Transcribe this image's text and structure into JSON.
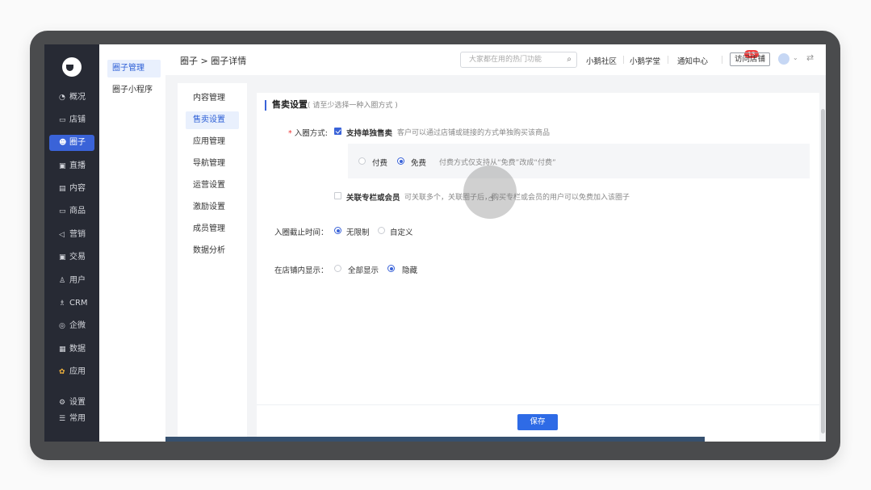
{
  "nav": {
    "items": [
      {
        "icon": "chart-icon",
        "label": "概况"
      },
      {
        "icon": "store-icon",
        "label": "店铺"
      },
      {
        "icon": "circle-group-icon",
        "label": "圈子"
      },
      {
        "icon": "live-icon",
        "label": "直播"
      },
      {
        "icon": "content-icon",
        "label": "内容"
      },
      {
        "icon": "goods-icon",
        "label": "商品"
      },
      {
        "icon": "marketing-icon",
        "label": "营销"
      },
      {
        "icon": "trade-icon",
        "label": "交易"
      },
      {
        "icon": "user-icon",
        "label": "用户"
      },
      {
        "icon": "crm-icon",
        "label": "CRM"
      },
      {
        "icon": "wecom-icon",
        "label": "企微"
      },
      {
        "icon": "data-icon",
        "label": "数据"
      },
      {
        "icon": "app-icon",
        "label": "应用"
      },
      {
        "icon": "settings-icon",
        "label": "设置"
      },
      {
        "icon": "common-icon",
        "label": "常用"
      }
    ]
  },
  "subnav": {
    "items": [
      "圈子管理",
      "圈子小程序"
    ]
  },
  "topbar": {
    "breadcrumb": "圈子 > 圈子详情",
    "search_placeholder": "大家都在用的热门功能",
    "links": [
      "小鹅社区",
      "小鹅学堂",
      "通知中心"
    ],
    "notice_badge": "13",
    "visit_store": "访问店铺"
  },
  "detail_nav": {
    "items": [
      "内容管理",
      "售卖设置",
      "应用管理",
      "导航管理",
      "运营设置",
      "激励设置",
      "成员管理",
      "数据分析"
    ]
  },
  "sale_settings": {
    "title": "售卖设置",
    "subtitle": "( 请至少选择一种入圈方式 )",
    "entry_label": "入圈方式:",
    "single_sale": "支持单独售卖",
    "single_sale_hint": "客户可以通过店铺或链接的方式单独购买该商品",
    "paid": "付费",
    "free": "免费",
    "price_hint": "付费方式仅支持从“免费”改成“付费”",
    "linked": "关联专栏或会员",
    "linked_hint": "可关联多个，关联圈子后，购买专栏或会员的用户可以免费加入该圈子",
    "deadline_label": "入圈截止时间：",
    "unlimited": "无限制",
    "custom": "自定义",
    "display_label": "在店铺内显示：",
    "show_all": "全部显示",
    "hide": "隐藏",
    "save": "保存"
  }
}
